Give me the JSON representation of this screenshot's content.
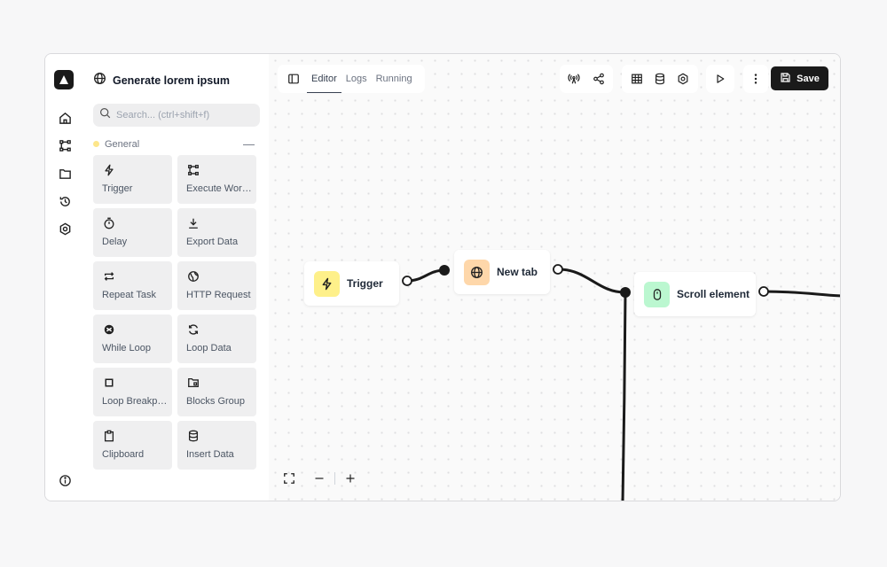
{
  "workflow": {
    "title": "Generate lorem ipsum"
  },
  "search": {
    "placeholder": "Search... (ctrl+shift+f)"
  },
  "rail": {
    "items": [
      "home-icon",
      "workflow-icon",
      "folder-icon",
      "history-icon",
      "settings-icon"
    ],
    "bottom": "info-icon"
  },
  "group": {
    "name": "General",
    "collapse_symbol": "—",
    "color": "#fde68a"
  },
  "blocks": [
    {
      "label": "Trigger",
      "icon": "lightning-icon"
    },
    {
      "label": "Execute Workflow",
      "icon": "workflow-icon"
    },
    {
      "label": "Delay",
      "icon": "timer-icon"
    },
    {
      "label": "Export Data",
      "icon": "download-icon"
    },
    {
      "label": "Repeat Task",
      "icon": "repeat-icon"
    },
    {
      "label": "HTTP Request",
      "icon": "globe-icon"
    },
    {
      "label": "While Loop",
      "icon": "loop-icon"
    },
    {
      "label": "Loop Data",
      "icon": "refresh-icon"
    },
    {
      "label": "Loop Breakpoint",
      "icon": "square-icon"
    },
    {
      "label": "Blocks Group",
      "icon": "folder-icon"
    },
    {
      "label": "Clipboard",
      "icon": "clipboard-icon"
    },
    {
      "label": "Insert Data",
      "icon": "database-icon"
    }
  ],
  "tabs": [
    {
      "label": "Editor",
      "active": true
    },
    {
      "label": "Logs",
      "active": false
    },
    {
      "label": "Running",
      "active": false
    }
  ],
  "toolbar": {
    "save_label": "Save"
  },
  "nodes": [
    {
      "id": "trigger",
      "label": "Trigger",
      "icon": "lightning-icon",
      "color": "#fef08a"
    },
    {
      "id": "new-tab",
      "label": "New tab",
      "icon": "globe-icon",
      "color": "#fed7aa"
    },
    {
      "id": "scroll",
      "label": "Scroll element",
      "icon": "mouse-icon",
      "color": "#bbf7d0"
    }
  ],
  "zoom": {
    "minus": "−",
    "plus": "+"
  }
}
